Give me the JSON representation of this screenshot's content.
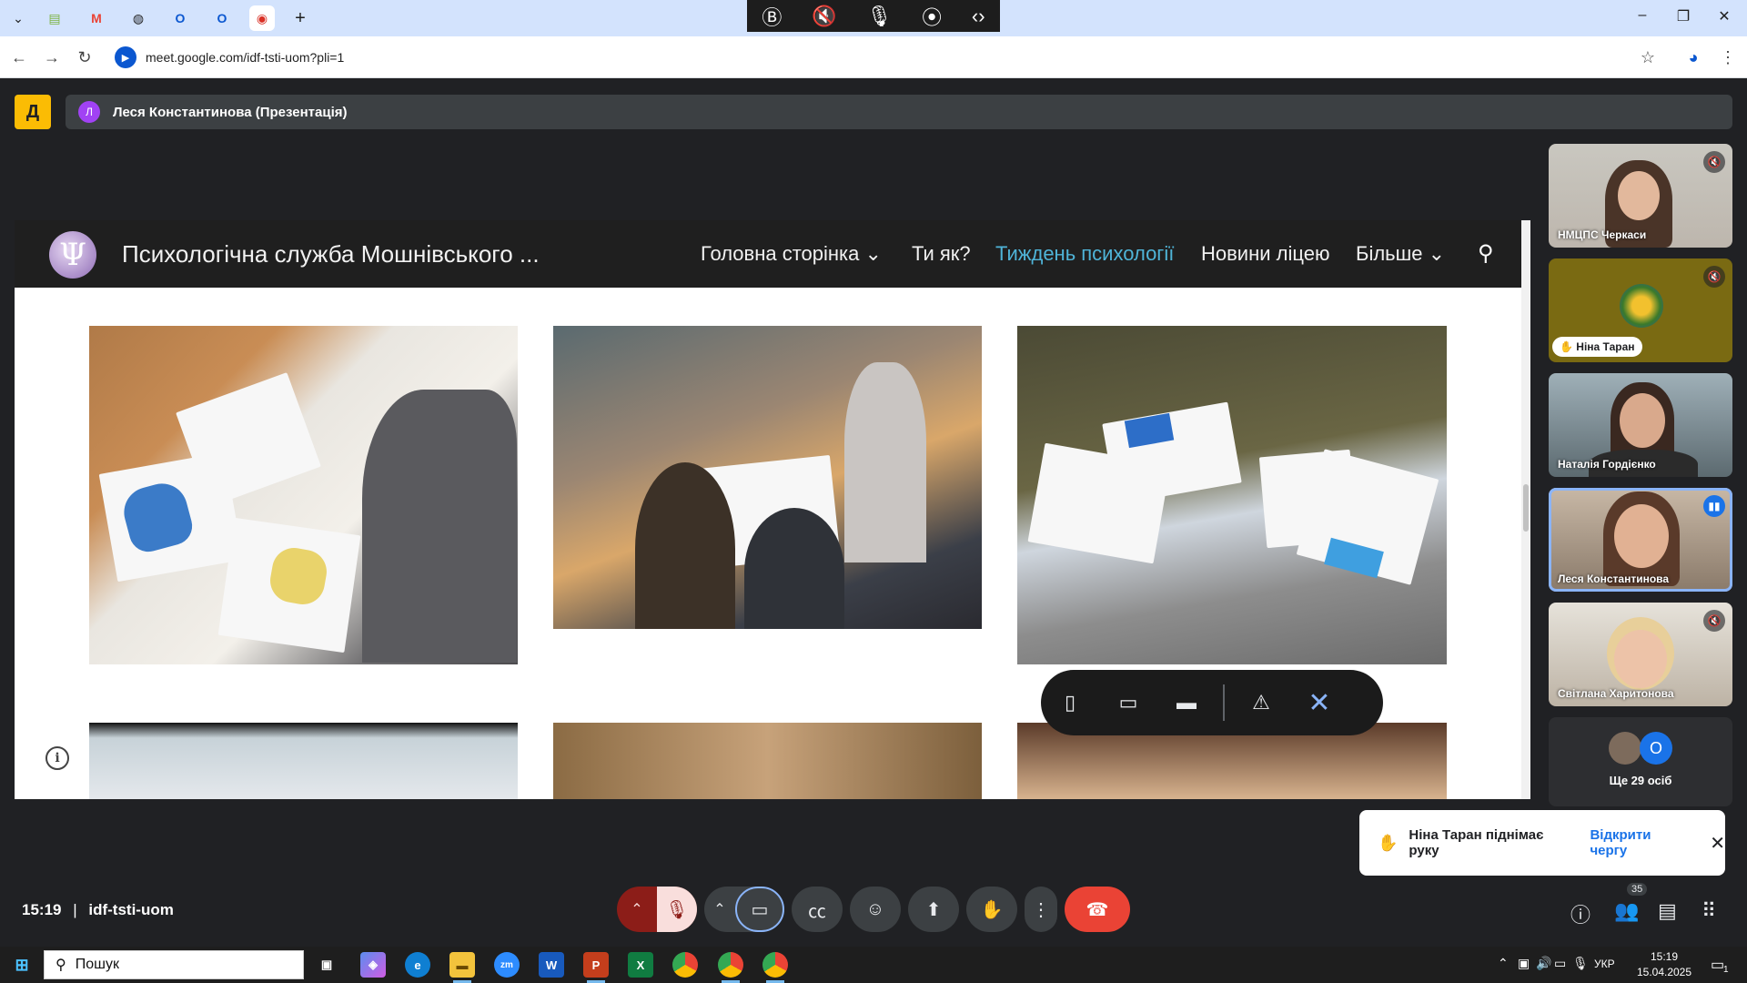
{
  "browser": {
    "tabs": [
      {
        "icon": "chevron-down-icon",
        "glyph": "⌄"
      },
      {
        "icon": "folder-icon",
        "glyph": "▤"
      },
      {
        "icon": "gmail-icon",
        "glyph": "M"
      },
      {
        "icon": "globe-icon",
        "glyph": "◍"
      },
      {
        "icon": "outlook-icon",
        "glyph": "O"
      },
      {
        "icon": "outlook-icon",
        "glyph": "O"
      },
      {
        "icon": "recording-icon",
        "glyph": "◉"
      }
    ],
    "new_tab": "+",
    "url": "meet.google.com/idf-tsti-uom?pli=1",
    "window_controls": {
      "minimize": "–",
      "restore": "❐",
      "close": "✕"
    }
  },
  "media_bar": {
    "items": [
      "Ⓑ",
      "🔇",
      "🎙",
      "⦿",
      "‹›"
    ]
  },
  "presentation": {
    "avatar_letter": "Л",
    "title": "Леся Константинова (Презентація)"
  },
  "site": {
    "title": "Психологічна служба Мошнівського ...",
    "logo": "Ψ",
    "nav": [
      "Головна сторінка ⌄",
      "Ти як?",
      "Тиждень психології",
      "Новини ліцею",
      "Більше ⌄"
    ]
  },
  "layout_pill": {
    "buttons": [
      "▯",
      "▭",
      "▬",
      "⚠",
      "✕"
    ]
  },
  "participants": [
    {
      "name": "НМЦПС Черкаси",
      "mic": "🔇"
    },
    {
      "name": "Ніна Таран",
      "mic": "🔇",
      "hand": "✋"
    },
    {
      "name": "Наталія Гордієнко",
      "mic": ""
    },
    {
      "name": "Леся Константинова",
      "mic": "▮▮"
    },
    {
      "name": "Світлана Харитонова",
      "mic": "🔇"
    }
  ],
  "more_participants": {
    "avatar_letter": "О",
    "label": "Ще 29 осіб"
  },
  "toast": {
    "message": "Ніна Таран піднімає руку",
    "action": "Відкрити чергу",
    "close": "✕"
  },
  "meeting": {
    "time": "15:19",
    "separator": "|",
    "code": "idf-tsti-uom",
    "participant_count": "35"
  },
  "taskbar": {
    "search_placeholder": "Пошук",
    "language": "УКР",
    "time": "15:19",
    "date": "15.04.2025",
    "notification_count": "1"
  },
  "colors": {
    "accent_nav": "#4fb4d8",
    "end_call": "#ea4335",
    "mic_off": "#f9dedc",
    "presenter_avatar": "#a142f4"
  }
}
